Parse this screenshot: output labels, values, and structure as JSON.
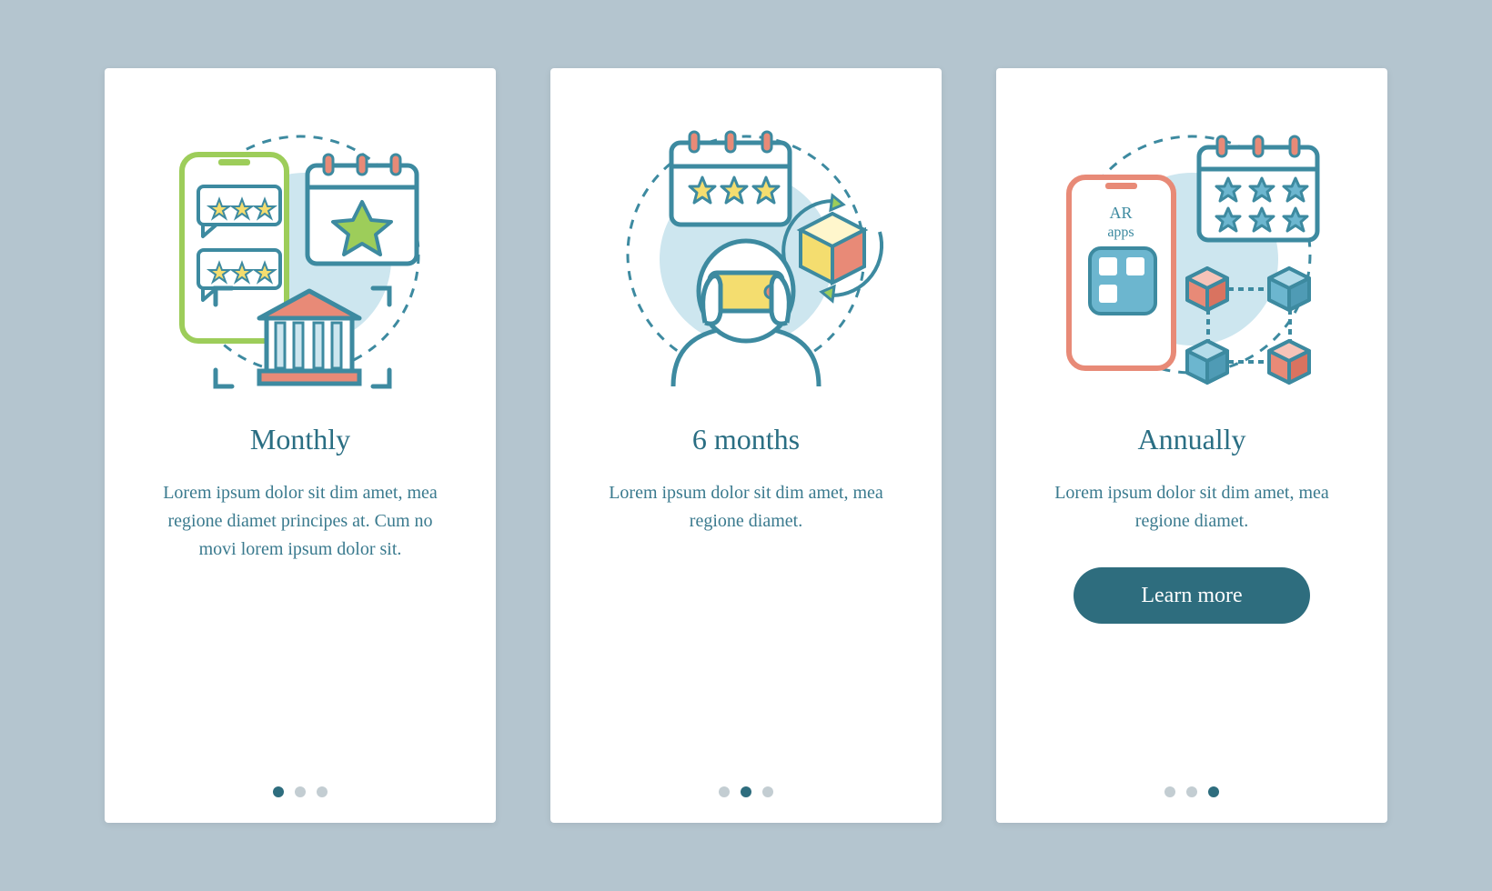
{
  "cards": [
    {
      "title": "Monthly",
      "body": "Lorem ipsum dolor sit dim amet, mea regione diamet principes at. Cum no movi lorem ipsum dolor sit.",
      "active_dot": 0,
      "cta": null,
      "ar_label": ""
    },
    {
      "title": "6 months",
      "body": "Lorem ipsum dolor sit dim amet, mea regione diamet.",
      "active_dot": 1,
      "cta": null,
      "ar_label": ""
    },
    {
      "title": "Annually",
      "body": "Lorem ipsum dolor sit dim amet, mea regione diamet.",
      "active_dot": 2,
      "cta": "Learn more",
      "ar_label": "AR apps"
    }
  ],
  "colors": {
    "bg": "#b4c5cf",
    "card": "#ffffff",
    "text": "#2a6e83",
    "accent": "#2e6d7e",
    "green": "#9dcd5a",
    "yellow": "#f4dd6f",
    "coral": "#e88a77",
    "blue": "#6cb6cf",
    "lightblue": "#cde6ef"
  }
}
